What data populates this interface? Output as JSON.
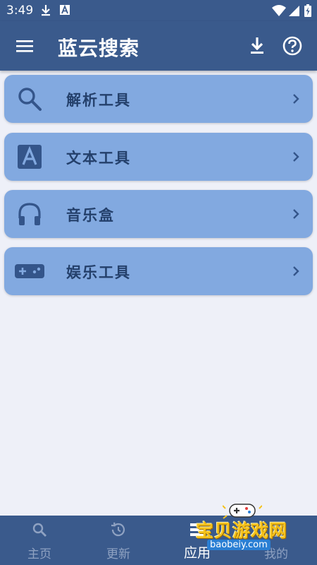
{
  "status_bar": {
    "time": "3:49",
    "icons": [
      "download-icon",
      "font-a-icon",
      "wifi-icon",
      "signal-icon",
      "battery-icon"
    ]
  },
  "app_bar": {
    "title": "蓝云搜索",
    "icons": [
      "menu-icon",
      "download-icon",
      "help-icon"
    ]
  },
  "cards": [
    {
      "label": "解析工具",
      "icon": "search-icon"
    },
    {
      "label": "文本工具",
      "icon": "font-a-icon"
    },
    {
      "label": "音乐盒",
      "icon": "headphones-icon"
    },
    {
      "label": "娱乐工具",
      "icon": "gamepad-icon"
    }
  ],
  "bottom_nav": {
    "items": [
      {
        "label": "主页",
        "icon": "search-icon"
      },
      {
        "label": "更新",
        "icon": "history-icon"
      },
      {
        "label": "应用",
        "icon": "apps-icon",
        "active": true
      },
      {
        "label": "我的",
        "icon": "person-icon"
      }
    ]
  },
  "watermark": {
    "text": "宝贝游戏网",
    "url": "baobeiy.com"
  },
  "colors": {
    "primary": "#3a5a8c",
    "card": "#82a9e0",
    "card_text": "#24406b",
    "background": "#eef0f8"
  }
}
